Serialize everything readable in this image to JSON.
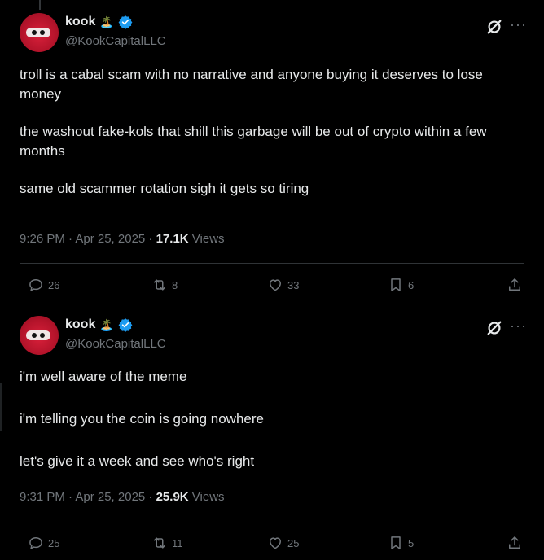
{
  "tweets": [
    {
      "author": {
        "name": "kook",
        "emoji": "🏝️",
        "handle": "@KookCapitalLLC"
      },
      "paragraphs": [
        "troll is a cabal scam with no narrative and anyone buying it deserves to lose money",
        "the washout fake-kols that shill this garbage will be out of crypto within a few months",
        "same old scammer rotation sigh it gets so tiring"
      ],
      "time": "9:26 PM · Apr 25, 2025 · ",
      "views_count": "17.1K",
      "views_label": " Views",
      "stats": {
        "replies": "26",
        "reposts": "8",
        "likes": "33",
        "bookmarks": "6"
      }
    },
    {
      "author": {
        "name": "kook",
        "emoji": "🏝️",
        "handle": "@KookCapitalLLC"
      },
      "paragraphs": [
        "i'm well aware of the meme",
        "i'm telling you the coin is going nowhere",
        "let's give it a week and see who's right"
      ],
      "time": "9:31 PM · Apr 25, 2025 · ",
      "views_count": "25.9K",
      "views_label": " Views",
      "stats": {
        "replies": "25",
        "reposts": "11",
        "likes": "25",
        "bookmarks": "5"
      }
    }
  ],
  "icons": {
    "verified": "verified-badge-icon",
    "grok": "grok-icon",
    "more": "more-icon",
    "reply": "reply-icon",
    "repost": "repost-icon",
    "like": "like-icon",
    "bookmark": "bookmark-icon",
    "share": "share-icon"
  },
  "more_glyph": "···",
  "colors": {
    "background": "#000000",
    "text": "#e7e9ea",
    "secondary": "#71767b",
    "verified": "#1d9bf0",
    "avatar": "#c8162e"
  }
}
